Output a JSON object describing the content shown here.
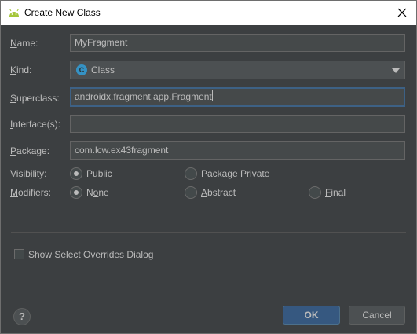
{
  "window": {
    "title": "Create New Class"
  },
  "form": {
    "name": {
      "label_hot": "N",
      "label_rest": "ame:",
      "value": "MyFragment"
    },
    "kind": {
      "label_hot": "K",
      "label_rest": "ind:",
      "value": "Class",
      "badge": "C"
    },
    "superclass": {
      "label_hot": "S",
      "label_rest": "uperclass:",
      "value": "androidx.fragment.app.Fragment"
    },
    "interfaces": {
      "label_hot": "I",
      "label_rest": "nterface(s):",
      "value": ""
    },
    "package": {
      "label_hot": "P",
      "label_rest": "ackage:",
      "value": "com.lcw.ex43fragment"
    }
  },
  "visibility": {
    "label_pre": "Visi",
    "label_hot": "b",
    "label_post": "ility:",
    "options": [
      {
        "pre": "P",
        "hot": "u",
        "post": "blic",
        "selected": true
      },
      {
        "pre": "Package Private",
        "hot": "",
        "post": "",
        "selected": false
      }
    ]
  },
  "modifiers": {
    "label_hot": "M",
    "label_rest": "odifiers:",
    "options": [
      {
        "pre": "N",
        "hot": "o",
        "post": "ne",
        "selected": true
      },
      {
        "pre": "",
        "hot": "A",
        "post": "bstract",
        "selected": false
      },
      {
        "pre": "",
        "hot": "F",
        "post": "inal",
        "selected": false
      }
    ]
  },
  "overrides_checkbox": {
    "pre": "Show Select Overrides ",
    "hot": "D",
    "post": "ialog",
    "checked": false
  },
  "buttons": {
    "help": "?",
    "ok": "OK",
    "cancel": "Cancel"
  },
  "colors": {
    "background": "#3c3f41",
    "field_bg": "#45494a",
    "focus_border": "#3d6185",
    "ok_bg": "#365880",
    "android_green": "#a4c639"
  },
  "icons": {
    "title": "android-icon",
    "close": "close-icon",
    "kind": "class-icon",
    "dropdown": "chevron-down-icon",
    "help": "help-icon"
  }
}
